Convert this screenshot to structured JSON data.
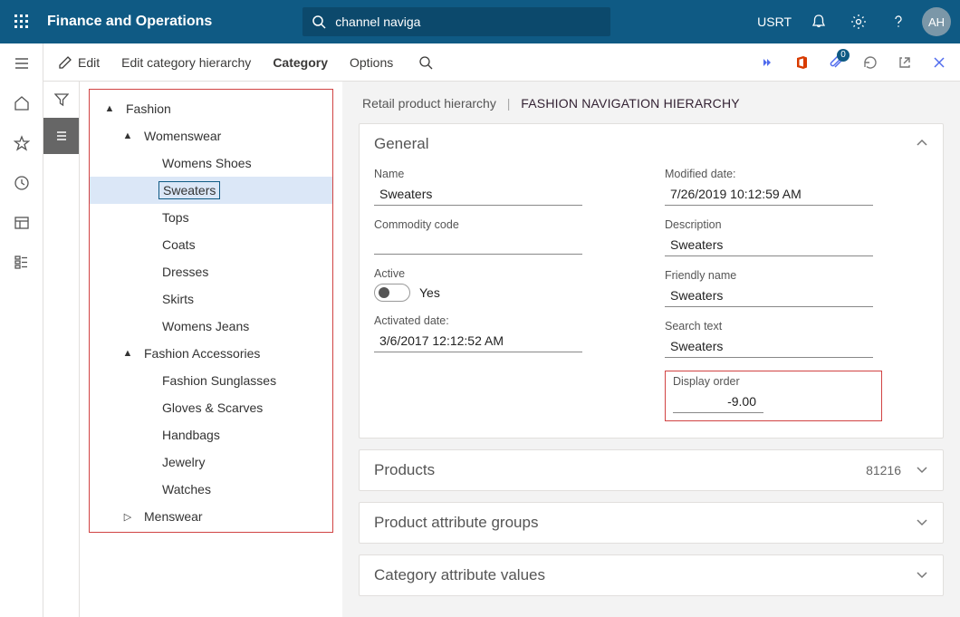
{
  "header": {
    "appTitle": "Finance and Operations",
    "searchText": "channel naviga",
    "company": "USRT",
    "avatar": "AH"
  },
  "actionBar": {
    "edit": "Edit",
    "editHierarchy": "Edit category hierarchy",
    "category": "Category",
    "options": "Options",
    "badge": "0"
  },
  "tree": {
    "n0": "Fashion",
    "n1": "Womenswear",
    "n1_0": "Womens Shoes",
    "n1_1": "Sweaters",
    "n1_2": "Tops",
    "n1_3": "Coats",
    "n1_4": "Dresses",
    "n1_5": "Skirts",
    "n1_6": "Womens Jeans",
    "n2": "Fashion Accessories",
    "n2_0": "Fashion Sunglasses",
    "n2_1": "Gloves & Scarves",
    "n2_2": "Handbags",
    "n2_3": "Jewelry",
    "n2_4": "Watches",
    "n3": "Menswear"
  },
  "crumb": {
    "root": "Retail product hierarchy",
    "cur": "FASHION NAVIGATION HIERARCHY"
  },
  "general": {
    "title": "General",
    "name_l": "Name",
    "name_v": "Sweaters",
    "commodity_l": "Commodity code",
    "commodity_v": "",
    "active_l": "Active",
    "active_v": "Yes",
    "activated_l": "Activated date:",
    "activated_v": "3/6/2017 12:12:52 AM",
    "modified_l": "Modified date:",
    "modified_v": "7/26/2019 10:12:59 AM",
    "description_l": "Description",
    "description_v": "Sweaters",
    "friendly_l": "Friendly name",
    "friendly_v": "Sweaters",
    "search_l": "Search text",
    "search_v": "Sweaters",
    "display_l": "Display order",
    "display_v": "-9.00"
  },
  "sections": {
    "products_t": "Products",
    "products_c": "81216",
    "pag_t": "Product attribute groups",
    "cav_t": "Category attribute values"
  }
}
